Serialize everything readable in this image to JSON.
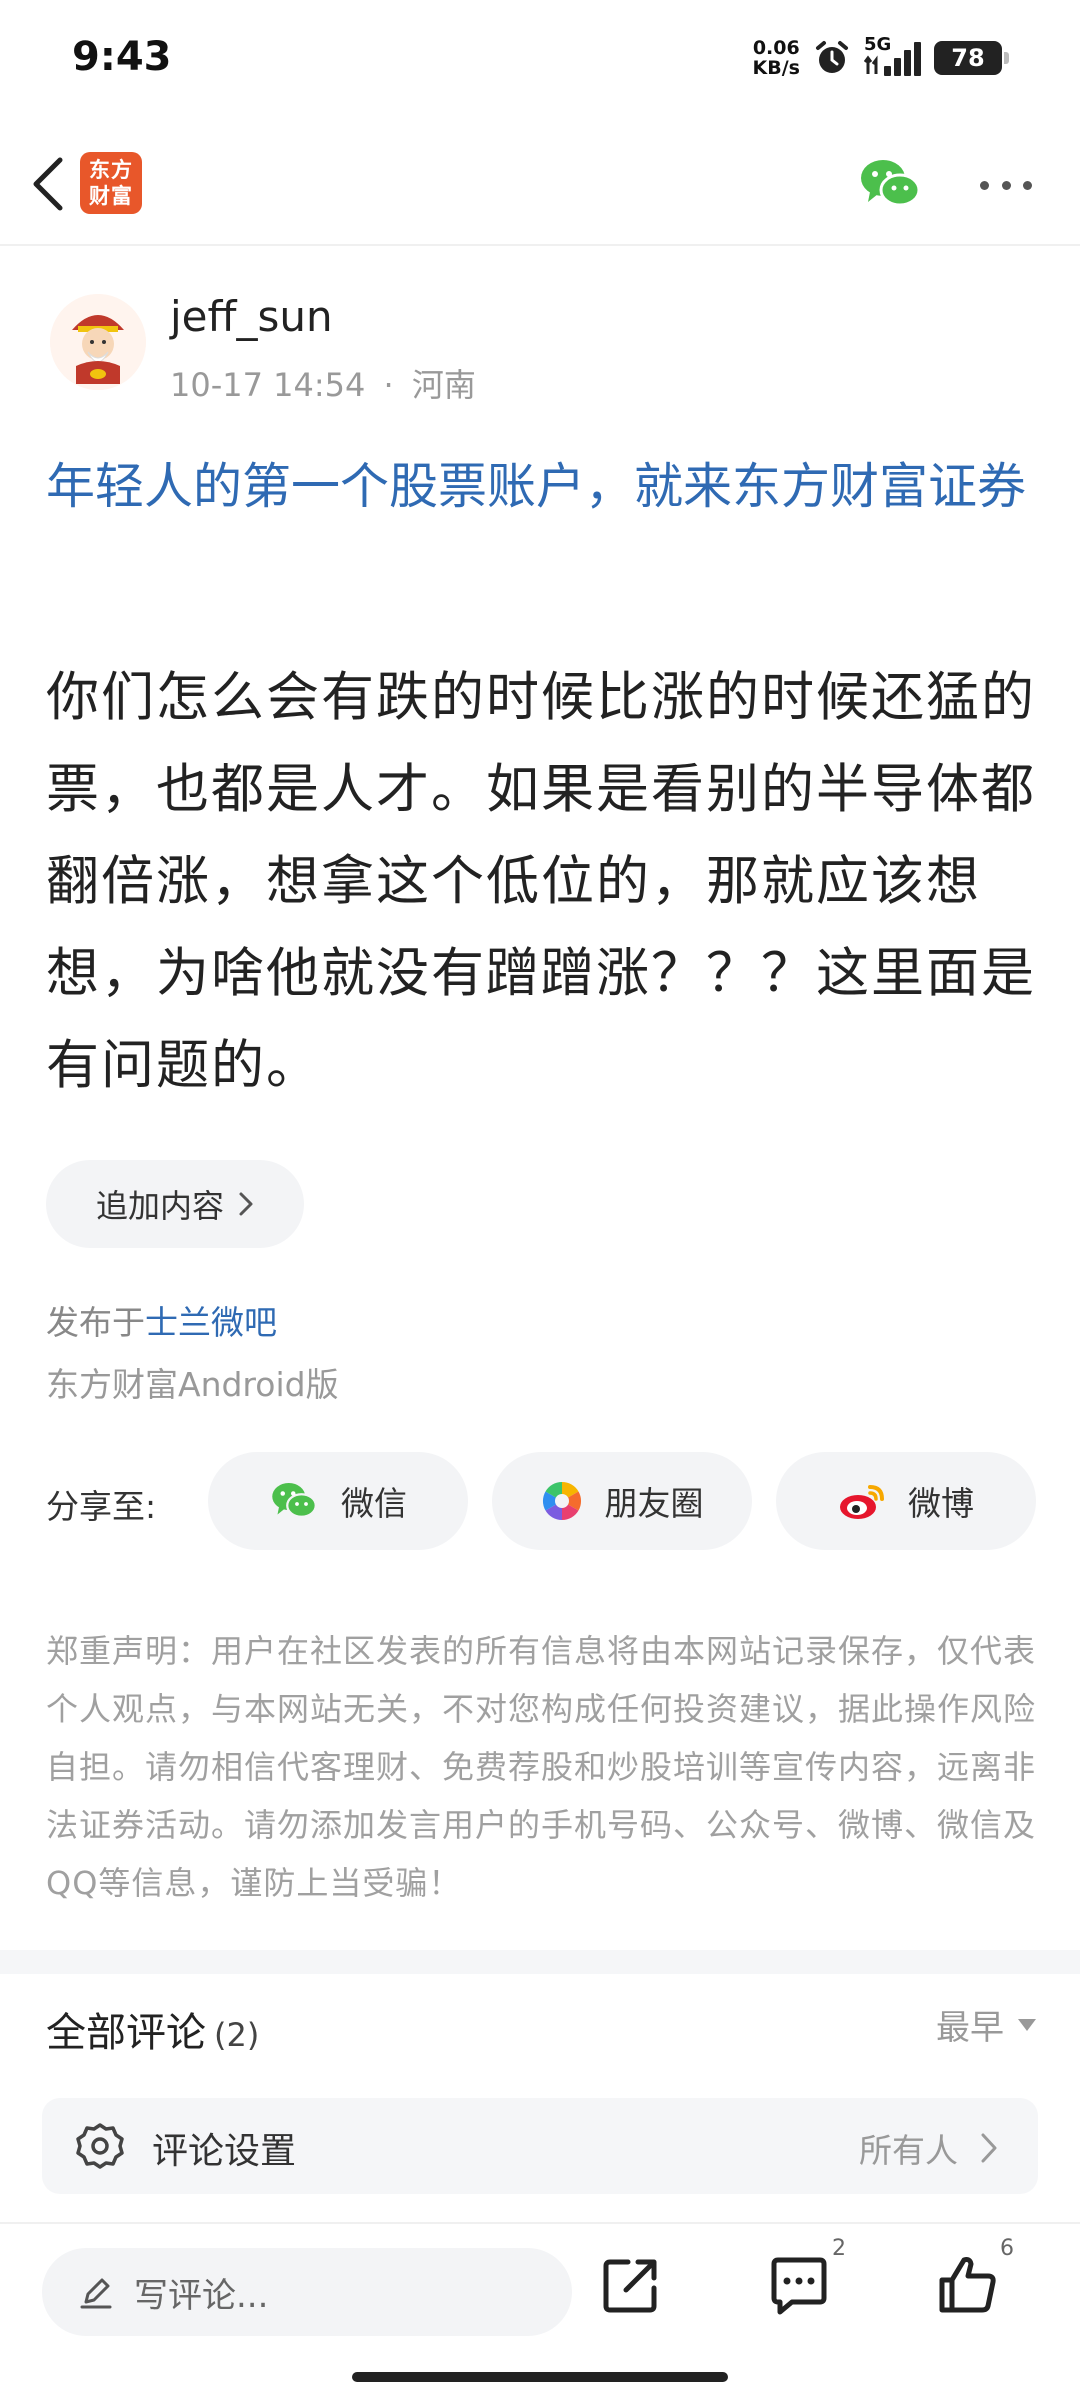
{
  "status_bar": {
    "time": "9:43",
    "net_speed_value": "0.06",
    "net_speed_unit": "KB/s",
    "network": "5G",
    "battery": "78"
  },
  "header": {
    "logo_text": "东方财富",
    "logo_line1": "东方",
    "logo_line2": "财富",
    "accent_color": "#e8572a"
  },
  "author": {
    "name": "jeff_sun",
    "time": "10-17 14:54",
    "separator": "·",
    "location": "河南"
  },
  "post": {
    "title": "年轻人的第一个股票账户，就来东方财富证券",
    "body": "你们怎么会有跌的时候比涨的时候还猛的票，也都是人才。如果是看别的半导体都翻倍涨，想拿这个低位的，那就应该想想，为啥他就没有蹭蹭涨？？？这里面是有问题的。",
    "append_button": "追加内容",
    "published_prefix": "发布于",
    "published_bar": "士兰微吧",
    "platform": "东方财富Android版"
  },
  "share": {
    "label": "分享至:",
    "options": [
      {
        "label": "微信",
        "icon": "wechat-icon"
      },
      {
        "label": "朋友圈",
        "icon": "moments-icon"
      },
      {
        "label": "微博",
        "icon": "weibo-icon"
      }
    ]
  },
  "disclaimer": "郑重声明：用户在社区发表的所有信息将由本网站记录保存，仅代表个人观点，与本网站无关，不对您构成任何投资建议，据此操作风险自担。请勿相信代客理财、免费荐股和炒股培训等宣传内容，远离非法证券活动。请勿添加发言用户的手机号码、公众号、微博、微信及QQ等信息，谨防上当受骗！",
  "comments": {
    "title": "全部评论",
    "count": "(2)",
    "sort": "最早",
    "settings_label": "评论设置",
    "settings_value": "所有人"
  },
  "bottom_bar": {
    "input_placeholder": "写评论...",
    "comment_count": "2",
    "like_count": "6"
  },
  "colors": {
    "link_blue": "#2f6ab3",
    "wechat_green": "#4cbf4c",
    "weibo_red": "#e6162d"
  }
}
